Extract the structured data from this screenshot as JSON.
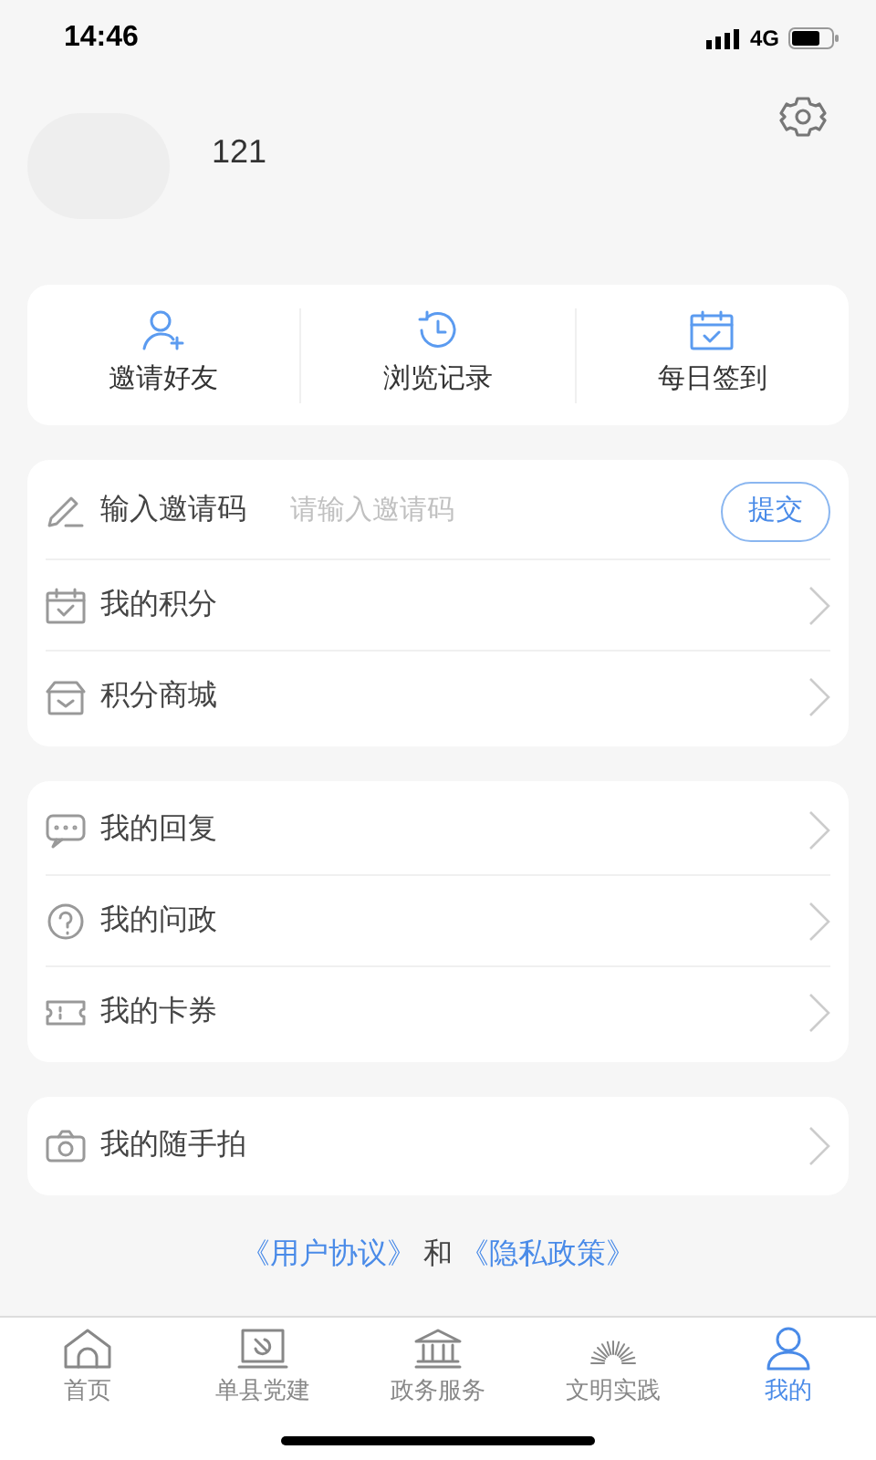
{
  "status_bar": {
    "time": "14:46",
    "network": "4G"
  },
  "profile": {
    "name": "121"
  },
  "quick_actions": [
    {
      "label": "邀请好友"
    },
    {
      "label": "浏览记录"
    },
    {
      "label": "每日签到"
    }
  ],
  "menu_groups": [
    {
      "items": [
        {
          "kind": "invite",
          "label": "输入邀请码",
          "placeholder": "请输入邀请码",
          "button": "提交"
        },
        {
          "kind": "link",
          "label": "我的积分"
        },
        {
          "kind": "link",
          "label": "积分商城"
        }
      ]
    },
    {
      "items": [
        {
          "kind": "link",
          "label": "我的回复"
        },
        {
          "kind": "link",
          "label": "我的问政"
        },
        {
          "kind": "link",
          "label": "我的卡券"
        }
      ]
    },
    {
      "items": [
        {
          "kind": "link",
          "label": "我的随手拍"
        }
      ]
    }
  ],
  "footer": [
    {
      "kind": "link",
      "text": "《用户协议》"
    },
    {
      "kind": "text",
      "text": "和"
    },
    {
      "kind": "link",
      "text": "《隐私政策》"
    }
  ],
  "tabs": [
    {
      "label": "首页",
      "selected": false
    },
    {
      "label": "单县党建",
      "selected": false
    },
    {
      "label": "政务服务",
      "selected": false
    },
    {
      "label": "文明实践",
      "selected": false
    },
    {
      "label": "我的",
      "selected": true
    }
  ]
}
